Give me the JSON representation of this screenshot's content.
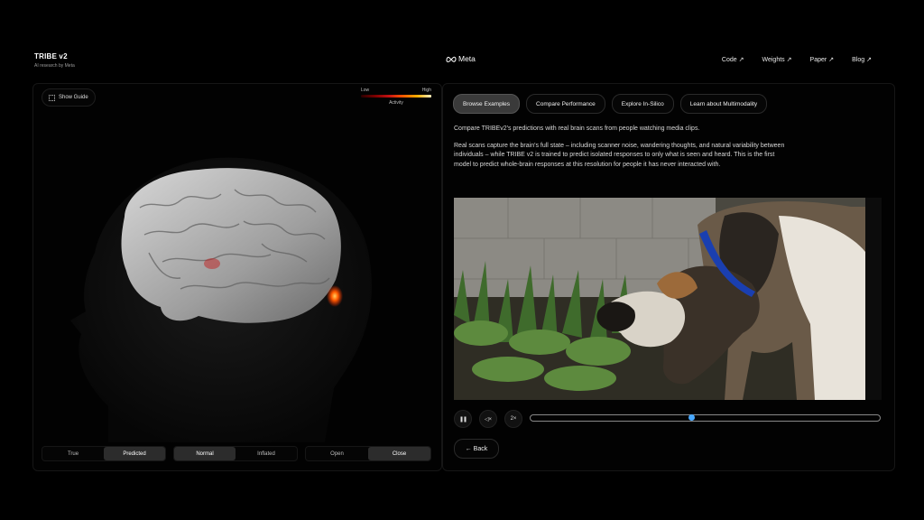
{
  "header": {
    "title": "TRIBE v2",
    "subtitle": "AI research by Meta",
    "logo_text": "Meta",
    "nav": [
      {
        "label": "Code",
        "icon": "arrow-up-right-icon"
      },
      {
        "label": "Weights",
        "icon": "arrow-up-right-icon"
      },
      {
        "label": "Paper",
        "icon": "arrow-up-right-icon"
      },
      {
        "label": "Blog",
        "icon": "arrow-up-right-icon"
      }
    ]
  },
  "left_panel": {
    "guide_label": "Show Guide",
    "legend": {
      "low": "Low",
      "high": "High",
      "caption": "Activity"
    },
    "toggle_source": [
      "True",
      "Predicted"
    ],
    "toggle_surface": [
      "Normal",
      "Inflated"
    ],
    "toggle_mouth": [
      "Open",
      "Close"
    ],
    "selected": {
      "source": "Predicted",
      "surface": "Normal",
      "mouth": "Close"
    }
  },
  "right_panel": {
    "tabs": [
      "Browse Examples",
      "Compare Performance",
      "Explore In-Silico",
      "Learn about Multimodality"
    ],
    "active_tab": "Browse Examples",
    "intro": "Compare TRIBEv2's predictions with real brain scans from people watching media clips.",
    "body": "Real scans capture the brain's full state – including scanner noise, wandering thoughts, and natural variability between individuals – while TRIBE v2 is trained to predict isolated responses to only what is seen and heard. This is the first model to predict whole-brain responses at this resolution for people it has never interacted with.",
    "player": {
      "pause_icon": "pause-icon",
      "mute_label": "◁×",
      "speed_label": "2×",
      "progress": 0.46
    },
    "back_label": "← Back"
  },
  "colors": {
    "accent": "#48a8ff",
    "activity_hot": "#ff5a00",
    "background": "#000000"
  }
}
